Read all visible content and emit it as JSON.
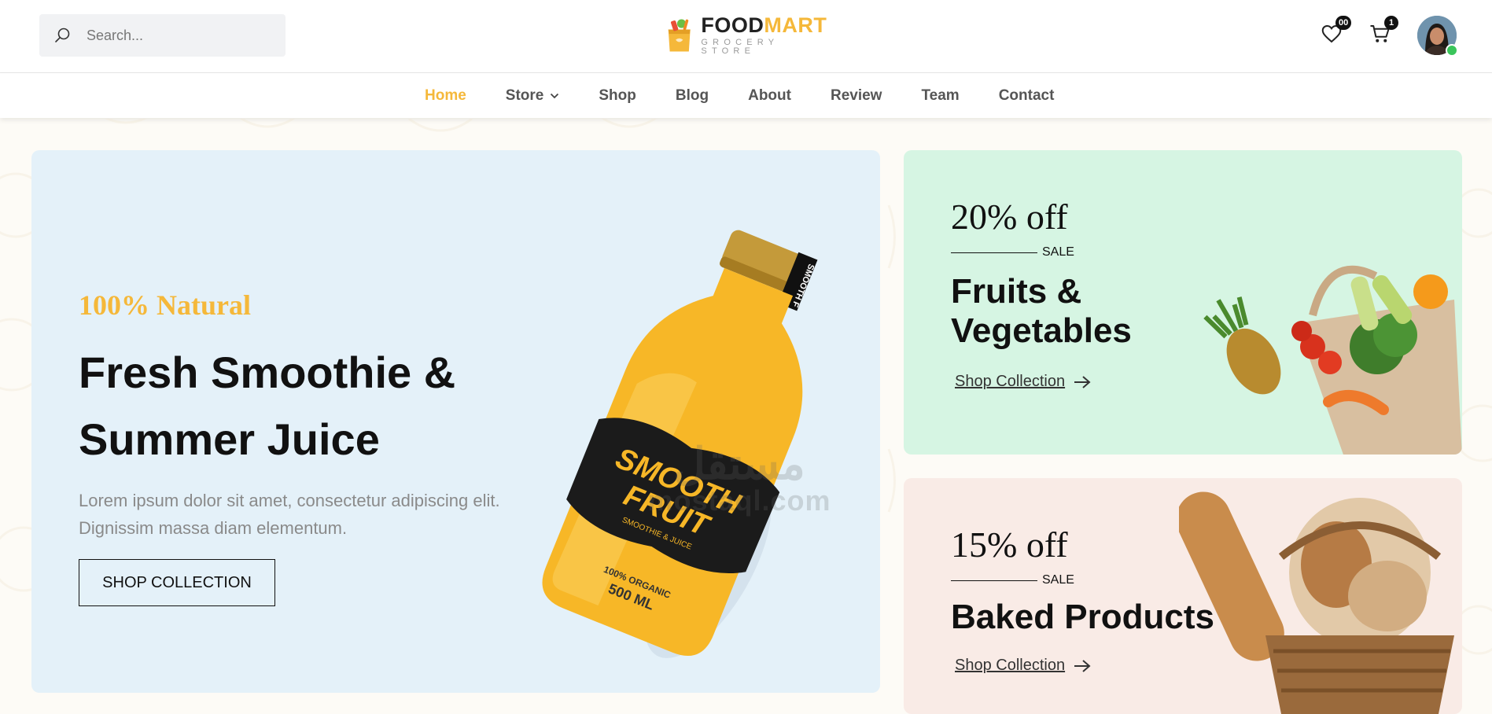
{
  "header": {
    "search_placeholder": "Search...",
    "logo": {
      "brand_part1": "FOOD",
      "brand_part2": "MART",
      "tagline": "GROCERY STORE"
    },
    "wishlist_count": "00",
    "cart_count": "1"
  },
  "nav": {
    "items": [
      {
        "label": "Home",
        "active": true
      },
      {
        "label": "Store",
        "dropdown": true
      },
      {
        "label": "Shop"
      },
      {
        "label": "Blog"
      },
      {
        "label": "About"
      },
      {
        "label": "Review"
      },
      {
        "label": "Team"
      },
      {
        "label": "Contact"
      }
    ]
  },
  "hero": {
    "kicker": "100% Natural",
    "title_line1": "Fresh Smoothie &",
    "title_line2": "Summer Juice",
    "description_line1": "Lorem ipsum dolor sit amet, consectetur adipiscing elit.",
    "description_line2": "Dignissim massa diam elementum.",
    "cta": "SHOP COLLECTION",
    "bottle_label": {
      "cap_text": "SMOOTH F",
      "line1": "SMOOTH",
      "line2": "FRUIT",
      "sub": "SMOOTHIE & JUICE",
      "organic": "100% ORGANIC",
      "volume": "500 ML"
    }
  },
  "watermark": {
    "arabic": "مستقل",
    "latin": "mostaql.com"
  },
  "promos": [
    {
      "discount": "20% off",
      "sale": "SALE",
      "title_line1": "Fruits &",
      "title_line2": "Vegetables",
      "link": "Shop Collection",
      "bg": "#d6f5e3"
    },
    {
      "discount": "15% off",
      "sale": "SALE",
      "title_line1": "Baked Products",
      "link": "Shop Collection",
      "bg": "#f9ebe6"
    }
  ],
  "colors": {
    "accent": "#f5b83a",
    "hero_bg": "#e4f1f9",
    "text_dark": "#111111",
    "online": "#3ac55b"
  }
}
